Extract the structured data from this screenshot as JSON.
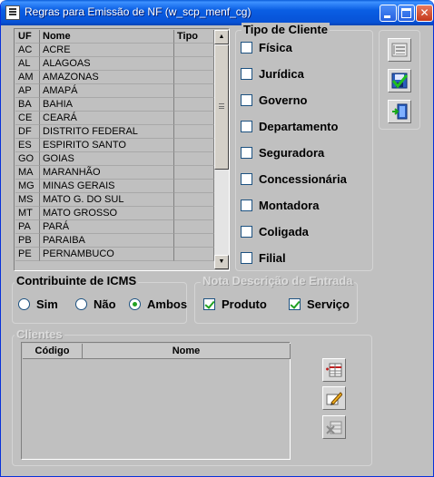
{
  "window": {
    "title": "Regras para Emissão de NF (w_scp_menf_cg)",
    "buttons": {
      "minimize": "minimize",
      "maximize": "maximize",
      "close": "close"
    }
  },
  "uf_list": {
    "headers": {
      "uf": "UF",
      "nome": "Nome",
      "tipo": "Tipo"
    },
    "rows": [
      {
        "uf": "AC",
        "nome": "ACRE",
        "tipo": ""
      },
      {
        "uf": "AL",
        "nome": "ALAGOAS",
        "tipo": ""
      },
      {
        "uf": "AM",
        "nome": "AMAZONAS",
        "tipo": ""
      },
      {
        "uf": "AP",
        "nome": "AMAPÁ",
        "tipo": ""
      },
      {
        "uf": "BA",
        "nome": "BAHIA",
        "tipo": ""
      },
      {
        "uf": "CE",
        "nome": "CEARÁ",
        "tipo": ""
      },
      {
        "uf": "DF",
        "nome": "DISTRITO FEDERAL",
        "tipo": ""
      },
      {
        "uf": "ES",
        "nome": "ESPIRITO SANTO",
        "tipo": ""
      },
      {
        "uf": "GO",
        "nome": "GOIAS",
        "tipo": ""
      },
      {
        "uf": "MA",
        "nome": "MARANHÃO",
        "tipo": ""
      },
      {
        "uf": "MG",
        "nome": "MINAS GERAIS",
        "tipo": ""
      },
      {
        "uf": "MS",
        "nome": "MATO G. DO SUL",
        "tipo": ""
      },
      {
        "uf": "MT",
        "nome": "MATO GROSSO",
        "tipo": ""
      },
      {
        "uf": "PA",
        "nome": "PARÁ",
        "tipo": ""
      },
      {
        "uf": "PB",
        "nome": "PARAIBA",
        "tipo": ""
      },
      {
        "uf": "PE",
        "nome": "PERNAMBUCO",
        "tipo": ""
      }
    ]
  },
  "tipo_cliente": {
    "title": "Tipo de Cliente",
    "options": [
      {
        "label": "Física",
        "checked": false
      },
      {
        "label": "Jurídica",
        "checked": false
      },
      {
        "label": "Governo",
        "checked": false
      },
      {
        "label": "Departamento",
        "checked": false
      },
      {
        "label": "Seguradora",
        "checked": false
      },
      {
        "label": "Concessionária",
        "checked": false
      },
      {
        "label": "Montadora",
        "checked": false
      },
      {
        "label": "Coligada",
        "checked": false
      },
      {
        "label": "Filial",
        "checked": false
      }
    ]
  },
  "contribuinte_icms": {
    "title": "Contribuinte de ICMS",
    "options": [
      {
        "label": "Sim",
        "checked": false
      },
      {
        "label": "Não",
        "checked": false
      },
      {
        "label": "Ambos",
        "checked": true
      }
    ]
  },
  "nota_descricao": {
    "title": "Nota Descrição de Entrada",
    "options": [
      {
        "label": "Produto",
        "checked": true
      },
      {
        "label": "Serviço",
        "checked": true
      }
    ]
  },
  "clientes": {
    "title": "Clientes",
    "headers": {
      "codigo": "Código",
      "nome": "Nome"
    }
  },
  "toolbar_icons": {
    "right_top": [
      "list-properties-icon",
      "save-checked-icon",
      "exit-door-icon"
    ],
    "clients": [
      "add-row-icon",
      "edit-pencil-icon",
      "delete-disabled-icon"
    ]
  }
}
